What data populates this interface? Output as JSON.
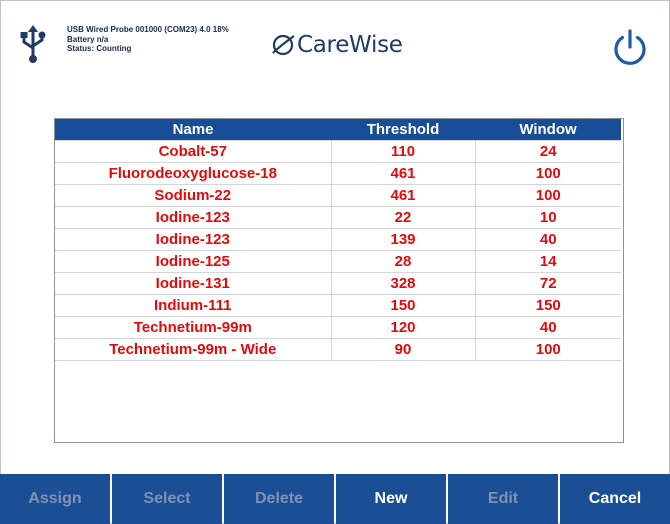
{
  "header": {
    "status_lines": [
      "USB Wired Probe 001000 (COM23) 4.0 18%",
      "Battery n/a",
      "Status: Counting"
    ],
    "logo_text": "CareWise",
    "icons": [
      "usb-icon",
      "carewise-logo-icon",
      "power-icon"
    ]
  },
  "colors": {
    "header_bg": "#174e97",
    "row_text": "#e20a0a",
    "button_bg": "#1b4f95",
    "button_disabled_text": "#7e93b4"
  },
  "table": {
    "columns": [
      "Name",
      "Threshold",
      "Window"
    ],
    "rows": [
      [
        "Cobalt-57",
        "110",
        "24"
      ],
      [
        "Fluorodeoxyglucose-18",
        "461",
        "100"
      ],
      [
        "Sodium-22",
        "461",
        "100"
      ],
      [
        "Iodine-123",
        "22",
        "10"
      ],
      [
        "Iodine-123",
        "139",
        "40"
      ],
      [
        "Iodine-125",
        "28",
        "14"
      ],
      [
        "Iodine-131",
        "328",
        "72"
      ],
      [
        "Indium-111",
        "150",
        "150"
      ],
      [
        "Technetium-99m",
        "120",
        "40"
      ],
      [
        "Technetium-99m - Wide",
        "90",
        "100"
      ]
    ]
  },
  "buttons": [
    {
      "label": "Assign",
      "enabled": false
    },
    {
      "label": "Select",
      "enabled": false
    },
    {
      "label": "Delete",
      "enabled": false
    },
    {
      "label": "New",
      "enabled": true
    },
    {
      "label": "Edit",
      "enabled": false
    },
    {
      "label": "Cancel",
      "enabled": true
    }
  ]
}
